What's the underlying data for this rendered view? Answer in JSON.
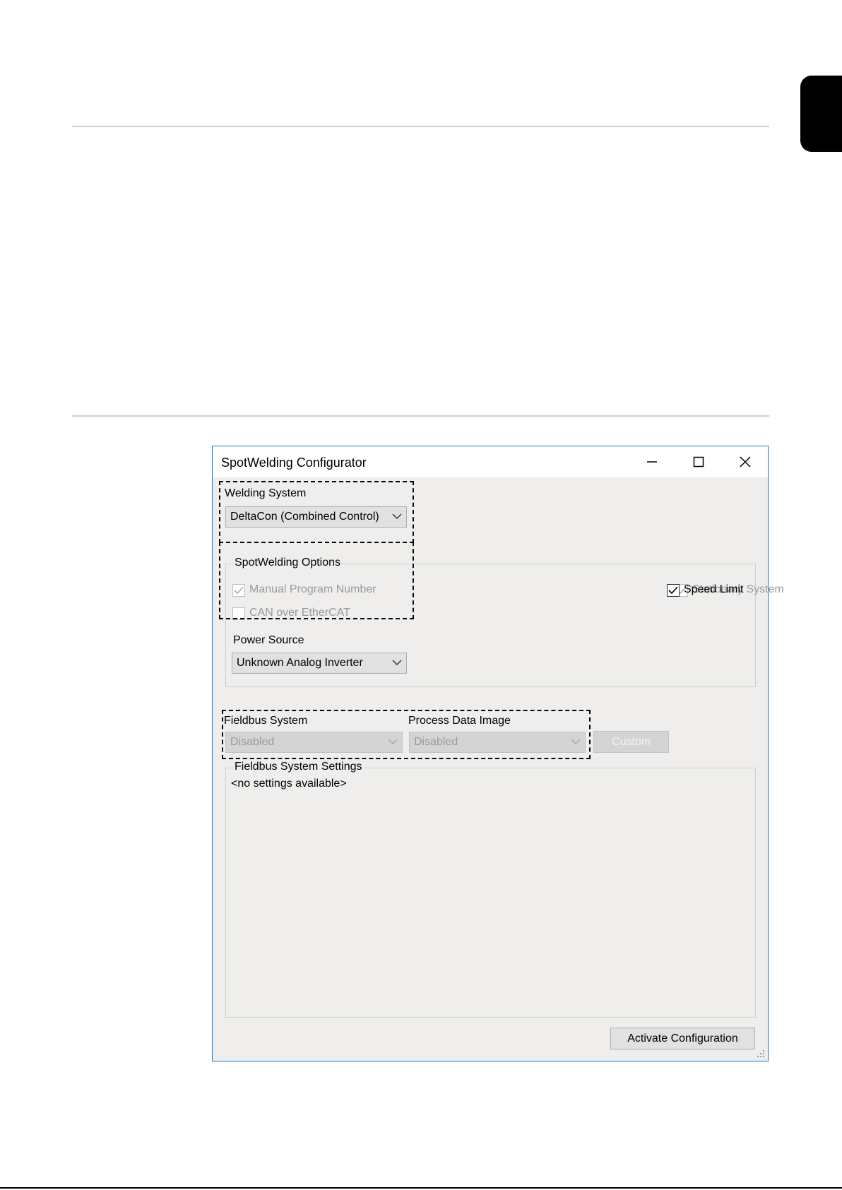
{
  "page": {
    "side_tab_color": "#000000"
  },
  "window": {
    "title": "SpotWelding Configurator",
    "controls": [
      "minimize-icon",
      "maximize-icon",
      "close-icon"
    ]
  },
  "welding_system": {
    "label": "Welding System",
    "selected": "DeltaCon (Combined Control)"
  },
  "spotwelding_options": {
    "title": "SpotWelding Options",
    "manual_program_number": {
      "label": "Manual Program Number",
      "checked": true,
      "enabled": false
    },
    "stationary_system": {
      "label": "Stationary System",
      "checked": true,
      "enabled": false
    },
    "speed_limit": {
      "label": "Speed Limit",
      "checked": true,
      "enabled": true
    },
    "can_over_ethercat": {
      "label": "CAN over EtherCAT",
      "checked": false,
      "enabled": false
    }
  },
  "power_source": {
    "label": "Power Source",
    "selected": "Unknown Analog Inverter"
  },
  "fieldbus": {
    "system_label": "Fieldbus System",
    "system_selected": "Disabled",
    "pdi_label": "Process Data Image",
    "pdi_selected": "Disabled",
    "custom_label": "Custom"
  },
  "fieldbus_settings": {
    "title": "Fieldbus System Settings",
    "content": "<no settings available>"
  },
  "actions": {
    "activate_label": "Activate Configuration"
  },
  "colors": {
    "window_border": "#1979ca",
    "client_bg": "#efeeed",
    "disabled_text": "#9a9a9a"
  }
}
